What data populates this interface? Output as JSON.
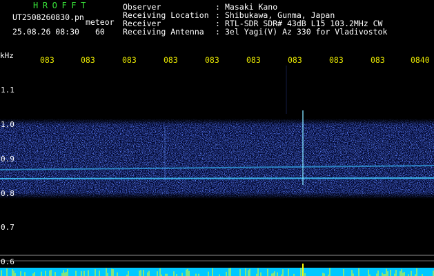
{
  "header": {
    "title": "HROFFT",
    "filename": "UT2508260830.pn",
    "mode": "meteor",
    "date_time": "25.08.26 08:30",
    "count": "60"
  },
  "meta": {
    "observer_key": "Observer",
    "observer_val": "Masaki Kano",
    "location_key": "Receiving Location",
    "location_val": "Shibukawa, Gunma, Japan",
    "receiver_key": "Receiver",
    "receiver_val": "RTL-SDR SDR# 43dB L15 103.2MHz CW",
    "antenna_key": "Receiving Antenna",
    "antenna_val": "3el Yagi(V) Az 330 for Vladivostok"
  },
  "axis": {
    "unit": "kHz",
    "time_labels": [
      "083",
      "083",
      "083",
      "083",
      "083",
      "083",
      "083",
      "083",
      "083",
      "0840"
    ],
    "freq_labels": [
      "1.1",
      "1.0",
      "0.9",
      "0.8",
      "0.7",
      "0.6"
    ]
  },
  "colors": {
    "background": "#000000",
    "title": "#39e639",
    "time_label": "#e8e800",
    "signal_low": "#1020c0",
    "signal_high": "#40d0ff",
    "bar": "#00c8ff",
    "spike": "#ffff00"
  }
}
